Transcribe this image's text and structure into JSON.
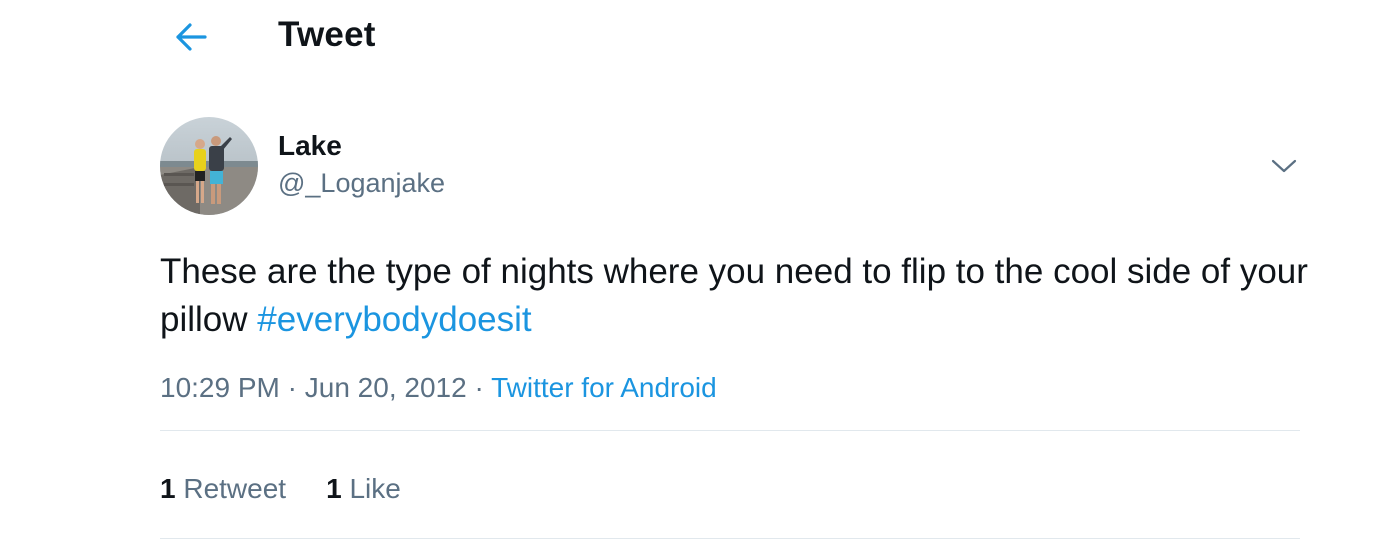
{
  "header": {
    "title": "Tweet",
    "back_icon": "arrow-left-icon"
  },
  "colors": {
    "accent": "#1b95e0",
    "text_primary": "#0f1419",
    "text_secondary": "#5b7083",
    "divider": "#e1e8ed"
  },
  "author": {
    "display_name": "Lake",
    "handle": "@_Loganjake",
    "avatar_icon": "profile-photo"
  },
  "more_icon": "chevron-down-icon",
  "tweet": {
    "text": "These are the type of nights where you need to flip to the cool side of your pillow",
    "hashtag": "#everybodydoesit"
  },
  "meta": {
    "time": "10:29 PM",
    "separator": "·",
    "date": "Jun 20, 2012",
    "source": "Twitter for Android"
  },
  "stats": {
    "retweets_count": "1",
    "retweets_label": "Retweet",
    "likes_count": "1",
    "likes_label": "Like"
  }
}
